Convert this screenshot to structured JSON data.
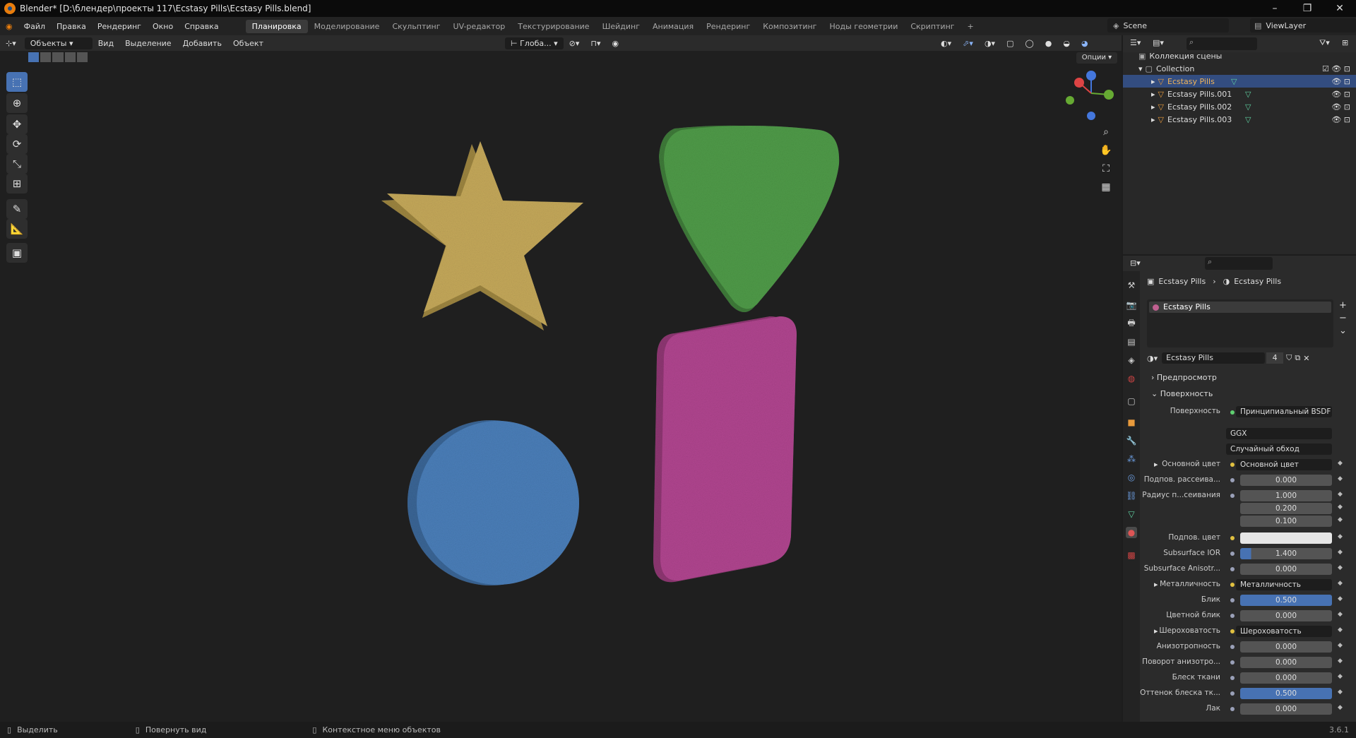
{
  "title": "Blender* [D:\\блендер\\проекты 117\\Ecstasy Pills\\Ecstasy Pills.blend]",
  "menus": [
    "Файл",
    "Правка",
    "Рендеринг",
    "Окно",
    "Справка"
  ],
  "workspaces": [
    "Планировка",
    "Моделирование",
    "Скульптинг",
    "UV-редактор",
    "Текстурирование",
    "Шейдинг",
    "Анимация",
    "Рендеринг",
    "Композитинг",
    "Ноды геометрии",
    "Скриптинг"
  ],
  "active_workspace": "Планировка",
  "scene": "Scene",
  "view_layer": "ViewLayer",
  "viewport_header": {
    "mode": "Объекты",
    "menu": [
      "Вид",
      "Выделение",
      "Добавить",
      "Объект"
    ],
    "orientation": "Глоба...",
    "options": "Опции"
  },
  "outliner": {
    "root": "Коллекция сцены",
    "collection": "Collection",
    "items": [
      "Ecstasy Pills",
      "Ecstasy Pills.001",
      "Ecstasy Pills.002",
      "Ecstasy Pills.003"
    ]
  },
  "properties": {
    "breadcrumb": [
      "Ecstasy Pills",
      "Ecstasy Pills"
    ],
    "slot": "Ecstasy Pills",
    "material_name": "Ecstasy Pills",
    "users": "4",
    "panel_preview": "Предпросмотр",
    "panel_surface": "Поверхность",
    "surface_label": "Поверхность",
    "surface_value": "Принципиальный BSDF",
    "distribution": "GGX",
    "subsurface_method": "Случайный обход",
    "rows": [
      {
        "label": "Основной цвет",
        "value": "Основной цвет",
        "kind": "link"
      },
      {
        "label": "Подпов. рассеива...",
        "value": "0.000",
        "kind": "num"
      },
      {
        "label": "Радиус п...сеивания",
        "value": "1.000",
        "kind": "num"
      },
      {
        "label": "",
        "value": "0.200",
        "kind": "num"
      },
      {
        "label": "",
        "value": "0.100",
        "kind": "num"
      },
      {
        "label": "Подпов. цвет",
        "value": "",
        "kind": "color"
      },
      {
        "label": "Subsurface IOR",
        "value": "1.400",
        "kind": "bar"
      },
      {
        "label": "Subsurface Anisotr...",
        "value": "0.000",
        "kind": "num"
      },
      {
        "label": "Металличность",
        "value": "Металличность",
        "kind": "link"
      },
      {
        "label": "Блик",
        "value": "0.500",
        "kind": "blue"
      },
      {
        "label": "Цветной блик",
        "value": "0.000",
        "kind": "num"
      },
      {
        "label": "Шероховатость",
        "value": "Шероховатость",
        "kind": "link"
      },
      {
        "label": "Анизотропность",
        "value": "0.000",
        "kind": "num"
      },
      {
        "label": "Поворот анизотро...",
        "value": "0.000",
        "kind": "num"
      },
      {
        "label": "Блеск ткани",
        "value": "0.000",
        "kind": "num"
      },
      {
        "label": "Оттенок блеска тк...",
        "value": "0.500",
        "kind": "blue"
      },
      {
        "label": "Лак",
        "value": "0.000",
        "kind": "num"
      }
    ]
  },
  "status": {
    "select": "Выделить",
    "rotate": "Повернуть вид",
    "context": "Контекстное меню объектов",
    "version": "3.6.1"
  },
  "colors": {
    "accent": "#4772b3",
    "star": "#c4a85a",
    "triangle": "#4f9a48",
    "circle": "#4a7eb8",
    "rect": "#b0458f"
  }
}
